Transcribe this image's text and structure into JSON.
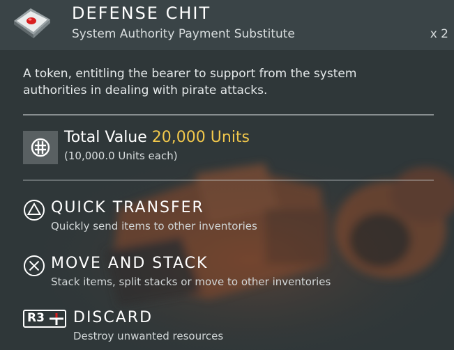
{
  "item": {
    "title": "DEFENSE CHIT",
    "subtitle": "System Authority Payment Substitute",
    "count": "x 2",
    "description": "A token, entitling the bearer to support from the system authorities in dealing with pirate attacks."
  },
  "value": {
    "label": "Total Value",
    "amount": "20,000 Units",
    "each": "(10,000.0 Units each)"
  },
  "actions": [
    {
      "button": "triangle",
      "title": "QUICK TRANSFER",
      "description": "Quickly send items to other inventories"
    },
    {
      "button": "cross",
      "title": "MOVE AND STACK",
      "description": "Stack items, split stacks or move to other inventories"
    },
    {
      "button": "R3",
      "title": "DISCARD",
      "description": "Destroy unwanted resources"
    }
  ],
  "colors": {
    "header_bg": "#3a4447",
    "panel_bg": "#2f3739",
    "accent_value": "#f2c84b",
    "token_red": "#d81f1f"
  },
  "icons": [
    "defense-chit-icon",
    "units-currency-icon",
    "triangle-button-icon",
    "cross-button-icon",
    "r3-button-icon"
  ]
}
